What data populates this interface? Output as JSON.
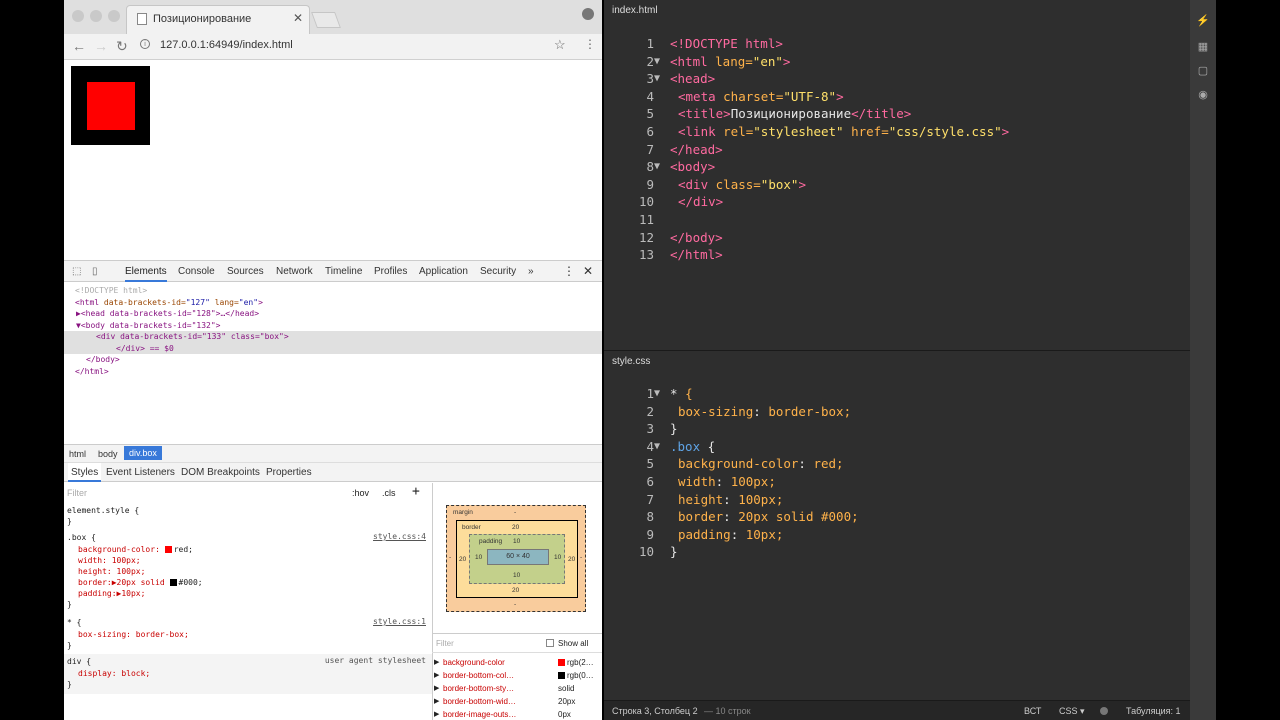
{
  "browser": {
    "tab_title": "Позиционирование",
    "url": "127.0.0.1:64949/index.html",
    "devtools_tabs": [
      "Elements",
      "Console",
      "Sources",
      "Network",
      "Timeline",
      "Profiles",
      "Application",
      "Security"
    ],
    "dom_lines": {
      "l1": "<!DOCTYPE html>",
      "l2_tag": "<html",
      "l2_attr": " data-brackets-id=",
      "l2_val": "\"127\"",
      "l2_attr2": " lang=",
      "l2_val2": "\"en\"",
      "l2_end": ">",
      "l3": "▶<head data-brackets-id=\"128\">…</head>",
      "l4": "▼<body data-brackets-id=\"132\">",
      "l5": "<div data-brackets-id=\"133\" class=\"box\">",
      "l6": "</div> == $0",
      "l7": "</body>",
      "l8": "</html>"
    },
    "breadcrumbs": [
      "html",
      "body",
      "div.box"
    ],
    "sub_tabs": [
      "Styles",
      "Event Listeners",
      "DOM Breakpoints",
      "Properties"
    ],
    "filter_placeholder": "Filter",
    "hov": ":hov",
    "cls": ".cls",
    "styles": {
      "element_style": "element.style {",
      "close": "}",
      "box_selector": ".box {",
      "box_link": "style.css:4",
      "bg_prop": "background-color:",
      "bg_val": "red;",
      "width": "width: 100px;",
      "height": "height: 100px;",
      "border": "border:▶20px solid ",
      "border_val": "#000;",
      "padding": "padding:▶10px;",
      "star_selector": "* {",
      "star_link": "style.css:1",
      "boxsizing": "box-sizing: border-box;",
      "div_selector": "div {",
      "ua": "user agent stylesheet",
      "display": "display: block;"
    },
    "boxmodel": {
      "margin": "margin",
      "margin_val": "-",
      "border": "border",
      "border_val": "20",
      "padding": "padding",
      "padding_val": "10",
      "content": "60 × 40",
      "side_20": "20",
      "side_10": "10",
      "dash": "-"
    },
    "computed": {
      "filter": "Filter",
      "show_all": "Show all",
      "rows": [
        {
          "prop": "background-color",
          "val": "rgb(2…"
        },
        {
          "prop": "border-bottom-col…",
          "val": "rgb(0…"
        },
        {
          "prop": "border-bottom-sty…",
          "val": "solid"
        },
        {
          "prop": "border-bottom-wid…",
          "val": "20px"
        },
        {
          "prop": "border-image-outs…",
          "val": "0px"
        }
      ]
    }
  },
  "editor": {
    "file1": "index.html",
    "file2": "style.css",
    "html_lines": [
      {
        "n": "1",
        "fold": ""
      },
      {
        "n": "2",
        "fold": "▼"
      },
      {
        "n": "3",
        "fold": "▼"
      },
      {
        "n": "4",
        "fold": ""
      },
      {
        "n": "5",
        "fold": ""
      },
      {
        "n": "6",
        "fold": ""
      },
      {
        "n": "7",
        "fold": ""
      },
      {
        "n": "8",
        "fold": "▼"
      },
      {
        "n": "9",
        "fold": ""
      },
      {
        "n": "10",
        "fold": ""
      },
      {
        "n": "11",
        "fold": ""
      },
      {
        "n": "12",
        "fold": ""
      },
      {
        "n": "13",
        "fold": ""
      }
    ],
    "html_text": {
      "l1": "<!DOCTYPE html>",
      "l2a": "<html ",
      "l2b": "lang=",
      "l2c": "\"en\"",
      "l2d": ">",
      "l3": "<head>",
      "l4a": "<meta ",
      "l4b": "charset=",
      "l4c": "\"UTF-8\"",
      "l4d": ">",
      "l5a": "<title>",
      "l5b": "Позиционирование",
      "l5c": "</title>",
      "l6a": "<link ",
      "l6b": "rel=",
      "l6c": "\"stylesheet\"",
      "l6d": " href=",
      "l6e": "\"css/style.css\"",
      "l6f": ">",
      "l7": "</head>",
      "l8": "<body>",
      "l9a": "<div ",
      "l9b": "class=",
      "l9c": "\"box\"",
      "l9d": ">",
      "l10": "</div>",
      "l12": "</body>",
      "l13": "</html>"
    },
    "css_lines": [
      {
        "n": "1",
        "fold": "▼"
      },
      {
        "n": "2",
        "fold": ""
      },
      {
        "n": "3",
        "fold": ""
      },
      {
        "n": "4",
        "fold": "▼"
      },
      {
        "n": "5",
        "fold": ""
      },
      {
        "n": "6",
        "fold": ""
      },
      {
        "n": "7",
        "fold": ""
      },
      {
        "n": "8",
        "fold": ""
      },
      {
        "n": "9",
        "fold": ""
      },
      {
        "n": "10",
        "fold": ""
      }
    ],
    "css_text": {
      "l1a": "* ",
      "l1b": "{",
      "l2a": "box-sizing",
      "l2b": ": ",
      "l2c": "border-box;",
      "l3": "}",
      "l4a": ".box",
      "l4b": " {",
      "l5a": "background-color",
      "l5b": ": ",
      "l5c": "red;",
      "l6a": "width",
      "l6b": ": ",
      "l6c": "100px;",
      "l7a": "height",
      "l7b": ": ",
      "l7c": "100px;",
      "l8a": "border",
      "l8b": ": ",
      "l8c": "20px solid #000;",
      "l9a": "padding",
      "l9b": ": ",
      "l9c": "10px;",
      "l10": "}"
    },
    "status": {
      "position": "Строка 3, Столбец 2",
      "lines": "— 10 строк",
      "mode": "ВСТ",
      "lang": "CSS ▾",
      "tabs": "Табуляция: 1"
    }
  }
}
